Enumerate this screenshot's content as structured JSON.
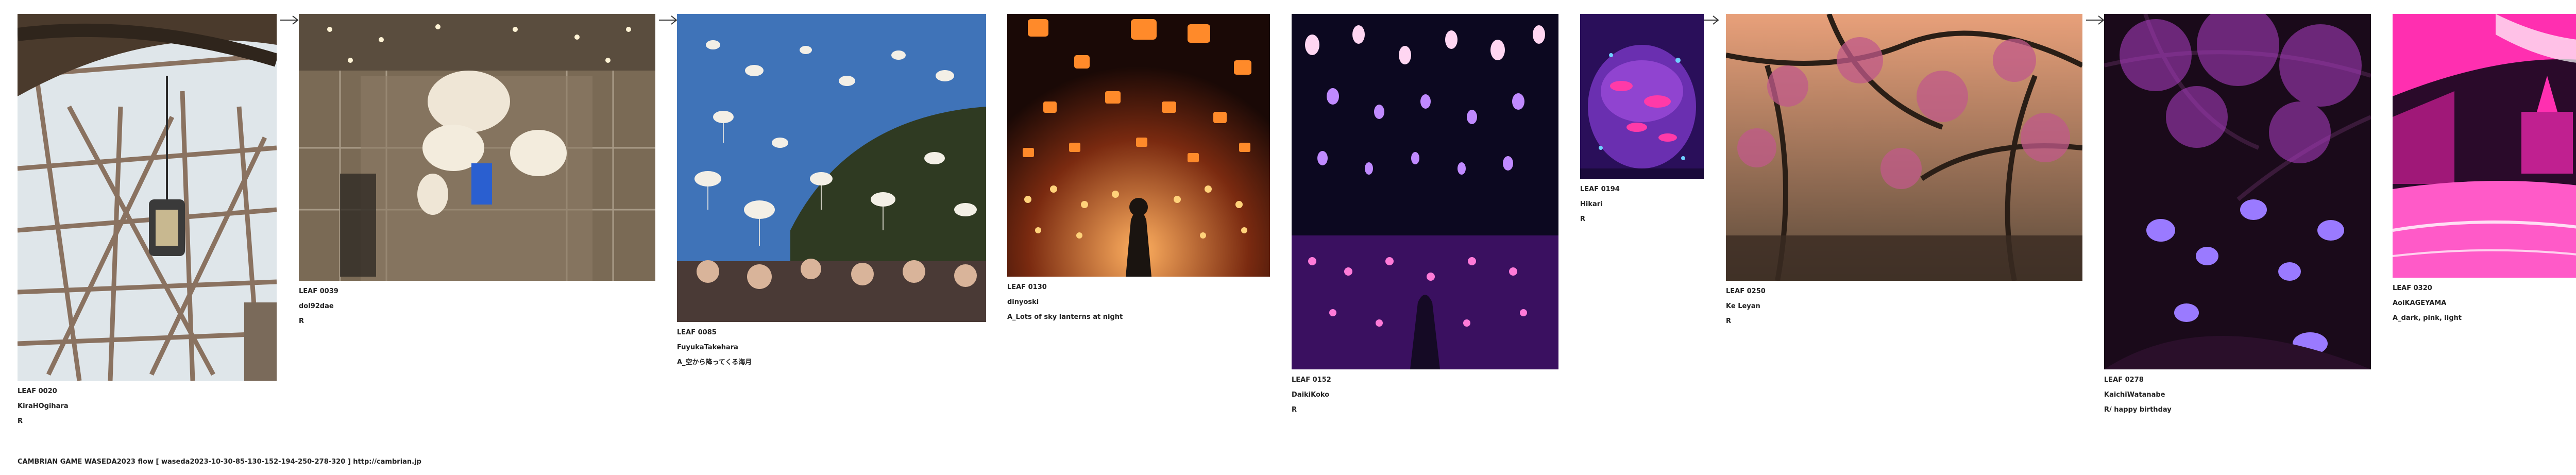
{
  "leaves": [
    {
      "id": "LEAF 0020",
      "author": "KiraHOgihara",
      "prompt": "R"
    },
    {
      "id": "LEAF 0039",
      "author": "dol92dae",
      "prompt": "R"
    },
    {
      "id": "LEAF 0085",
      "author": "FuyukaTakehara",
      "prompt": "A_空から降ってくる海月"
    },
    {
      "id": "LEAF 0130",
      "author": "dinyoski",
      "prompt": "A_Lots of sky lanterns at night"
    },
    {
      "id": "LEAF 0152",
      "author": "DaikiKoko",
      "prompt": "R"
    },
    {
      "id": "LEAF 0194",
      "author": "Hikari",
      "prompt": "R"
    },
    {
      "id": "LEAF 0250",
      "author": "Ke Leyan",
      "prompt": "R"
    },
    {
      "id": "LEAF 0278",
      "author": "KaichiWatanabe",
      "prompt": "R/ happy birthday"
    },
    {
      "id": "LEAF 0320",
      "author": "AoiKAGEYAMA",
      "prompt": "A_dark, pink, light"
    }
  ],
  "footer": {
    "text": "CAMBRIAN GAME  WASEDA2023  flow [ waseda2023-10-30-85-130-152-194-250-278-320 ]    http://cambrian.jp"
  },
  "images": [
    {
      "subject": "wooden roller coaster structure with hanging lantern",
      "palette": [
        "#dfe6ea",
        "#8a7260",
        "#4a3a2c"
      ]
    },
    {
      "subject": "crystal chandeliers in a glass atrium",
      "palette": [
        "#7a6a55",
        "#d9cfbf",
        "#2f2a24"
      ]
    },
    {
      "subject": "jellyfish falling from the sky over a crowd",
      "palette": [
        "#3f73b8",
        "#f3efe6",
        "#2f3a22"
      ]
    },
    {
      "subject": "sky lanterns at night",
      "palette": [
        "#1a0906",
        "#ff8a2a",
        "#ffd27a"
      ]
    },
    {
      "subject": "glowing lamps in a mirrored room",
      "palette": [
        "#0c0820",
        "#9a3cff",
        "#ff7ad8"
      ]
    },
    {
      "subject": "pink goldfish bowl",
      "palette": [
        "#2a0f5a",
        "#ff3aa8",
        "#6fd0ff"
      ]
    },
    {
      "subject": "cherry tree branches at dusk",
      "palette": [
        "#5a4a3a",
        "#e8a07a",
        "#c05a8a"
      ]
    },
    {
      "subject": "purple glowing flowers under a tree",
      "palette": [
        "#1a0a1a",
        "#b040c8",
        "#9a7aff"
      ]
    },
    {
      "subject": "pink stylized city street",
      "palette": [
        "#2a0a2a",
        "#ff2fb0",
        "#ffffff"
      ]
    }
  ]
}
